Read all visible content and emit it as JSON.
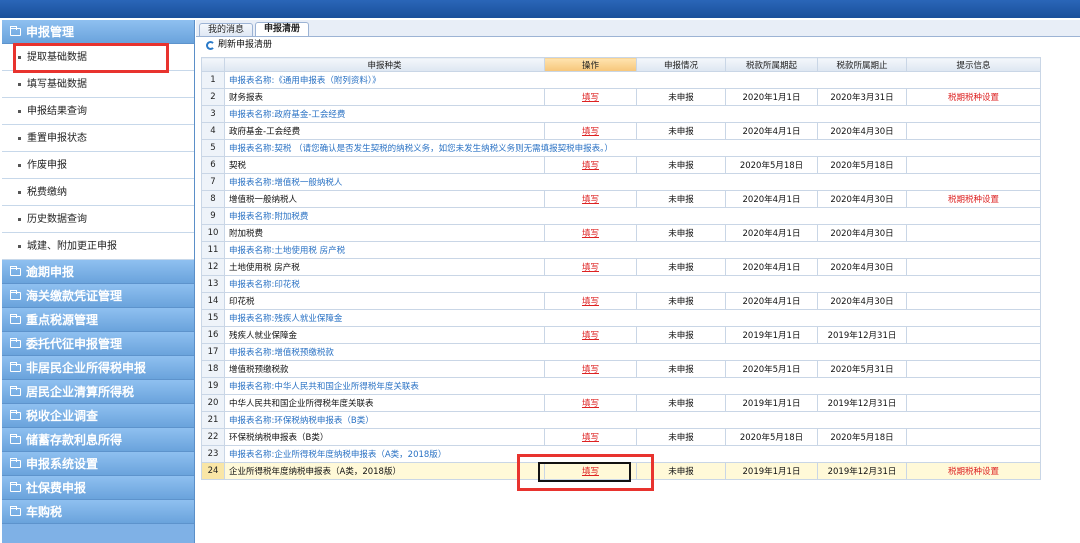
{
  "sidebar": {
    "top_section": "申报管理",
    "sub_items": [
      "提取基础数据",
      "填写基础数据",
      "申报结果查询",
      "重置申报状态",
      "作废申报",
      "税费缴纳",
      "历史数据查询",
      "城建、附加更正申报"
    ],
    "sections": [
      "逾期申报",
      "海关缴款凭证管理",
      "重点税源管理",
      "委托代征申报管理",
      "非居民企业所得税申报",
      "居民企业清算所得税",
      "税收企业调查",
      "储蓄存款利息所得",
      "申报系统设置",
      "社保费申报",
      "车购税"
    ]
  },
  "tabs": [
    {
      "label": "我的消息",
      "active": false
    },
    {
      "label": "申报清册",
      "active": true
    }
  ],
  "toolbar": {
    "refresh_label": "刷新申报清册"
  },
  "table": {
    "headers": [
      "",
      "申报种类",
      "操作",
      "申报情况",
      "税款所属期起",
      "税款所属期止",
      "提示信息"
    ],
    "rows": [
      {
        "n": "1",
        "group": "申报表名称:《通用申报表（附列资料）》"
      },
      {
        "n": "2",
        "name": "财务报表",
        "op": "填写",
        "status": "未申报",
        "start": "2020年1月1日",
        "end": "2020年3月31日",
        "tip": "税期税种设置"
      },
      {
        "n": "3",
        "group": "申报表名称:政府基金-工会经费"
      },
      {
        "n": "4",
        "name": "政府基金-工会经费",
        "op": "填写",
        "status": "未申报",
        "start": "2020年4月1日",
        "end": "2020年4月30日",
        "tip": ""
      },
      {
        "n": "5",
        "group": "申报表名称:契税 （请您确认是否发生契税的纳税义务，如您未发生纳税义务则无需填报契税申报表。）"
      },
      {
        "n": "6",
        "name": "契税",
        "op": "填写",
        "status": "未申报",
        "start": "2020年5月18日",
        "end": "2020年5月18日",
        "tip": ""
      },
      {
        "n": "7",
        "group": "申报表名称:增值税一般纳税人"
      },
      {
        "n": "8",
        "name": "增值税一般纳税人",
        "op": "填写",
        "status": "未申报",
        "start": "2020年4月1日",
        "end": "2020年4月30日",
        "tip": "税期税种设置"
      },
      {
        "n": "9",
        "group": "申报表名称:附加税费"
      },
      {
        "n": "10",
        "name": "附加税费",
        "op": "填写",
        "status": "未申报",
        "start": "2020年4月1日",
        "end": "2020年4月30日",
        "tip": ""
      },
      {
        "n": "11",
        "group": "申报表名称:土地使用税 房产税"
      },
      {
        "n": "12",
        "name": "土地使用税 房产税",
        "op": "填写",
        "status": "未申报",
        "start": "2020年4月1日",
        "end": "2020年4月30日",
        "tip": ""
      },
      {
        "n": "13",
        "group": "申报表名称:印花税"
      },
      {
        "n": "14",
        "name": "印花税",
        "op": "填写",
        "status": "未申报",
        "start": "2020年4月1日",
        "end": "2020年4月30日",
        "tip": ""
      },
      {
        "n": "15",
        "group": "申报表名称:残疾人就业保障金"
      },
      {
        "n": "16",
        "name": "残疾人就业保障金",
        "op": "填写",
        "status": "未申报",
        "start": "2019年1月1日",
        "end": "2019年12月31日",
        "tip": ""
      },
      {
        "n": "17",
        "group": "申报表名称:增值税预缴税款"
      },
      {
        "n": "18",
        "name": "增值税预缴税款",
        "op": "填写",
        "status": "未申报",
        "start": "2020年5月1日",
        "end": "2020年5月31日",
        "tip": ""
      },
      {
        "n": "19",
        "group": "申报表名称:中华人民共和国企业所得税年度关联表"
      },
      {
        "n": "20",
        "name": "中华人民共和国企业所得税年度关联表",
        "op": "填写",
        "status": "未申报",
        "start": "2019年1月1日",
        "end": "2019年12月31日",
        "tip": ""
      },
      {
        "n": "21",
        "group": "申报表名称:环保税纳税申报表（B类）"
      },
      {
        "n": "22",
        "name": "环保税纳税申报表（B类）",
        "op": "填写",
        "status": "未申报",
        "start": "2020年5月18日",
        "end": "2020年5月18日",
        "tip": ""
      },
      {
        "n": "23",
        "group": "申报表名称:企业所得税年度纳税申报表（A类，2018版）"
      },
      {
        "n": "24",
        "name": "企业所得税年度纳税申报表（A类，2018版）",
        "op": "填写",
        "status": "未申报",
        "start": "2019年1月1日",
        "end": "2019年12月31日",
        "tip": "税期税种设置",
        "highlight": true
      }
    ]
  },
  "colors": {
    "annotation_red": "#e8332e",
    "link_red": "#dd2222",
    "group_blue": "#2a72c4",
    "sidebar_blue": "#7fb1e6"
  }
}
